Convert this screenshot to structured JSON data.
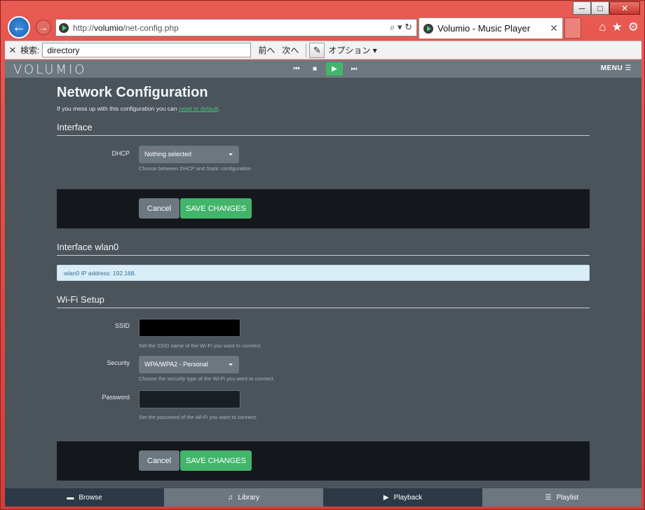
{
  "browser": {
    "url_prefix": "http://",
    "url_host": "volumio",
    "url_path": "/net-config.php",
    "tab_title": "Volumio - Music Player",
    "addr_tools": "⌕ ▾ ↻"
  },
  "find_bar": {
    "label": "検索:",
    "value": "directory",
    "prev": "前へ",
    "next": "次へ",
    "options": "オプション"
  },
  "app": {
    "logo": "VOLUMIO",
    "menu": "MENU"
  },
  "page": {
    "title": "Network Configuration",
    "subtitle_before": "If you mess up with this configuration you can ",
    "subtitle_link": "reset to default",
    "subtitle_after": "."
  },
  "interface": {
    "title": "Interface",
    "dhcp_label": "DHCP",
    "dhcp_value": "Nothing selected",
    "dhcp_help": "Choose between DHCP and Static configuration",
    "cancel": "Cancel",
    "save": "SAVE CHANGES"
  },
  "wlan": {
    "title": "Interface wlan0",
    "ip_info": "wlan0 IP address: 192.168."
  },
  "wifi": {
    "title": "Wi-Fi Setup",
    "ssid_label": "SSID",
    "ssid_help": "Set the SSID name of the Wi-Fi you want to connect.",
    "security_label": "Security",
    "security_value": "WPA/WPA2 - Personal",
    "security_help": "Choose the security type of the Wi-Fi you want to connect.",
    "password_label": "Password",
    "password_help": "Set the password of the Wi-Fi you want to connect.",
    "cancel": "Cancel",
    "save": "SAVE CHANGES"
  },
  "bottom_nav": [
    {
      "label": "Browse",
      "icon": "folder-icon"
    },
    {
      "label": "Library",
      "icon": "music-note-icon"
    },
    {
      "label": "Playback",
      "icon": "play-icon"
    },
    {
      "label": "Playlist",
      "icon": "list-icon"
    }
  ],
  "colors": {
    "accent": "#42b56b",
    "page_bg": "#4b535b",
    "band_bg": "#14181c",
    "info_bg": "#d9edf7"
  }
}
